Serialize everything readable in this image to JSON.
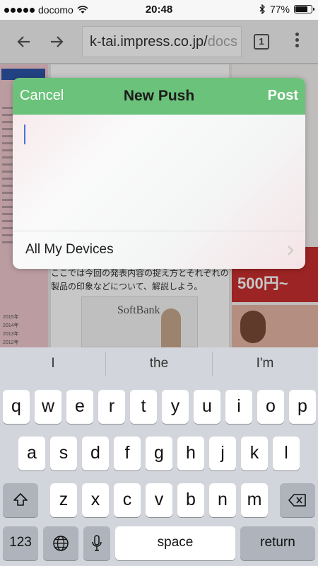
{
  "status": {
    "carrier": "docomo",
    "time": "20:48",
    "battery": "77%",
    "battery_level": 0.77
  },
  "browser": {
    "url_main": "k-tai.impress.co.jp/",
    "url_dim": "docs",
    "tab_count": "1"
  },
  "web": {
    "body_text": "ここでは今回の発表内容の捉え方とそれぞれの製品の印象などについて、解説しよう。",
    "brand": "SoftBank",
    "ad_price": "500円~",
    "years": [
      "2015年",
      "2014年",
      "2013年",
      "2012年"
    ]
  },
  "dialog": {
    "cancel": "Cancel",
    "title": "New Push",
    "post": "Post",
    "message_value": "",
    "target": "All My Devices"
  },
  "keyboard": {
    "suggestions": [
      "I",
      "the",
      "I'm"
    ],
    "row1": [
      "q",
      "w",
      "e",
      "r",
      "t",
      "y",
      "u",
      "i",
      "o",
      "p"
    ],
    "row2": [
      "a",
      "s",
      "d",
      "f",
      "g",
      "h",
      "j",
      "k",
      "l"
    ],
    "row3": [
      "z",
      "x",
      "c",
      "v",
      "b",
      "n",
      "m"
    ],
    "numbers": "123",
    "space": "space",
    "return": "return"
  },
  "icons": [
    "wifi-icon",
    "bluetooth-icon",
    "battery-icon",
    "back-arrow-icon",
    "forward-arrow-icon",
    "menu-dots-icon",
    "shift-icon",
    "backspace-icon",
    "globe-icon",
    "microphone-icon",
    "chevron-right-icon"
  ]
}
